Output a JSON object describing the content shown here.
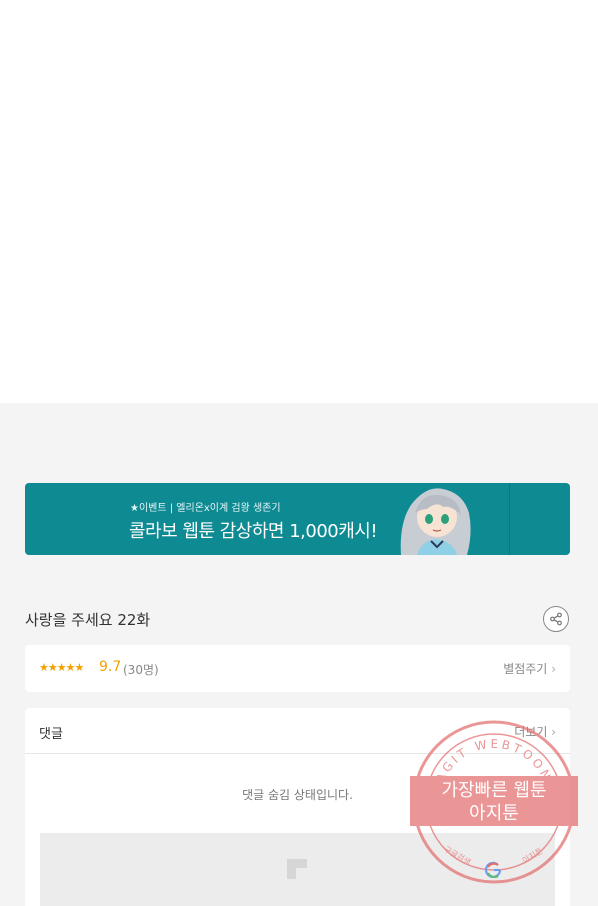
{
  "banner": {
    "subtitle": "★이벤트 | 엘리온x이계 검왕 생존기",
    "headline": "콜라보 웹툰 감상하면 1,000캐시!",
    "color": "#0e8a93"
  },
  "episode": {
    "title": "사랑을 주세요 22화",
    "share_icon": "share-icon"
  },
  "rating": {
    "stars": "★★★★★",
    "score": "9.7",
    "count": "(30명)",
    "rate_label": "별점주기",
    "star_color": "#f3a100"
  },
  "comments": {
    "title": "댓글",
    "more_label": "더보기",
    "hidden_message": "댓글 숨김 상태입니다."
  },
  "watermark": {
    "arc_text": "AGIT WEBTOON",
    "line1": "가장빠른 웹툰",
    "line2": "아지툰",
    "bottom_left": "구글검색",
    "bottom_right": "아지툰",
    "color": "#e57373"
  }
}
